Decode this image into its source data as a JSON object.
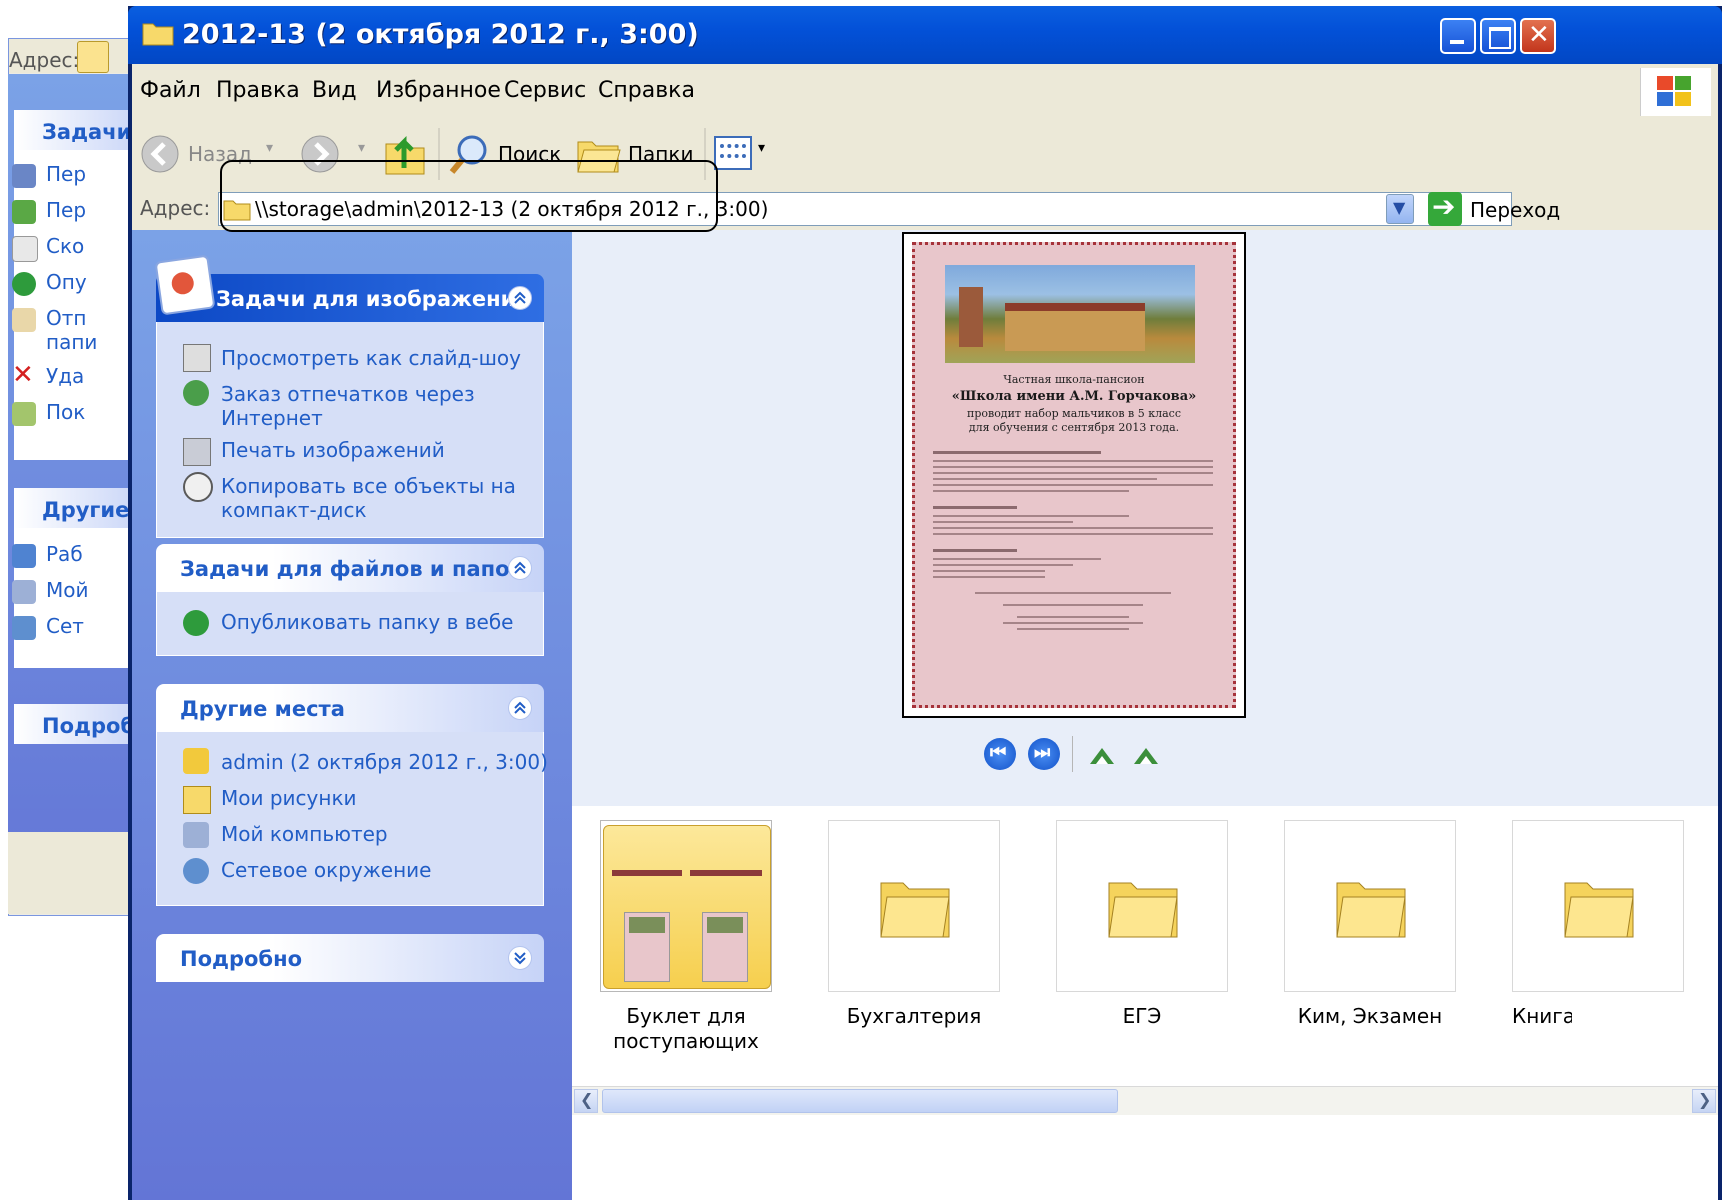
{
  "background_window": {
    "address_label": "Адрес:",
    "tasks_heading": "Задачи",
    "task_items": [
      "Пер",
      "Пер",
      "Ско",
      "Опу",
      "Отп",
      "Уда",
      "Пок"
    ],
    "task_item_extra": "папи",
    "other_heading": "Другие",
    "other_items": [
      "Раб",
      "Мой",
      "Сет"
    ],
    "details_heading": "Подроб"
  },
  "window": {
    "title": "2012-13 (2 октября 2012 г., 3:00)",
    "menu": [
      "Файл",
      "Правка",
      "Вид",
      "Избранное",
      "Сервис",
      "Справка"
    ],
    "toolbar": {
      "back": "Назад",
      "search": "Поиск",
      "folders": "Папки"
    },
    "address": {
      "label": "Адрес:",
      "value": "\\\\storage\\admin\\2012-13 (2 октября 2012 г., 3:00)",
      "go": "Переход"
    }
  },
  "left_pane": {
    "image_tasks": {
      "title": "Задачи для изображений",
      "items": [
        "Просмотреть как слайд-шоу",
        "Заказ отпечатков через Интернет",
        "Печать изображений",
        "Копировать все объекты на компакт-диск"
      ]
    },
    "file_tasks": {
      "title": "Задачи для файлов и папок",
      "items": [
        "Опубликовать папку в вебе"
      ]
    },
    "other_places": {
      "title": "Другие места",
      "items": [
        "admin (2 октября 2012 г., 3:00)",
        "Мои рисунки",
        "Мой компьютер",
        "Сетевое окружение"
      ]
    },
    "details": {
      "title": "Подробно"
    }
  },
  "poster": {
    "line1": "Частная школа-пансион",
    "line2": "«Школа имени А.М. Горчакова»",
    "line3": "проводит набор мальчиков в 5 класс",
    "line4": "для обучения с сентября 2013 года."
  },
  "folders": [
    "Буклет для поступающих",
    "Бухгалтерия",
    "ЕГЭ",
    "Ким, Экзамен",
    "Книга"
  ],
  "colors": {
    "title_blue": "#0351d8",
    "panel_blue": "#6375d6",
    "link_blue": "#215dc6",
    "folder_yellow": "#f7d96a"
  }
}
